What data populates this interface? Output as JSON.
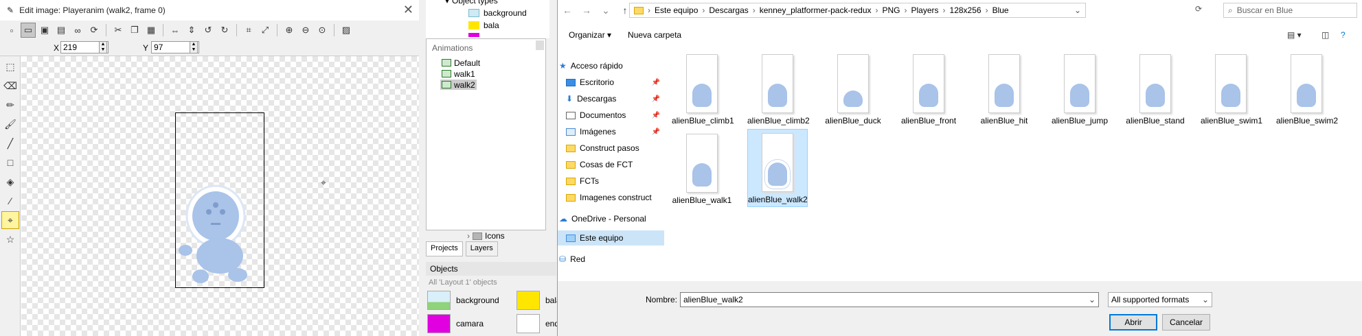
{
  "editor": {
    "title": "Edit image: Playeranim (walk2, frame 0)",
    "close": "✕",
    "x_label": "X",
    "x_value": "219",
    "y_label": "Y",
    "y_value": "97"
  },
  "object_types": {
    "header": "Object types",
    "items": [
      "background",
      "bala",
      "camara"
    ]
  },
  "animations": {
    "title": "Animations",
    "items": [
      "Default",
      "walk1",
      "walk2"
    ],
    "selected": "walk2"
  },
  "project_tabs": [
    "Projects",
    "Layers"
  ],
  "objects_panel": {
    "title": "Objects",
    "subtitle": "All 'Layout 1' objects",
    "items": [
      "background",
      "bala",
      "camara",
      "end"
    ]
  },
  "dialog": {
    "path": [
      "Este equipo",
      "Descargas",
      "kenney_platformer-pack-redux",
      "PNG",
      "Players",
      "128x256",
      "Blue"
    ],
    "search_placeholder": "Buscar en Blue",
    "organize": "Organizar",
    "new_folder": "Nueva carpeta",
    "nav": [
      {
        "label": "Acceso rápido",
        "pin": false
      },
      {
        "label": "Escritorio",
        "pin": true
      },
      {
        "label": "Descargas",
        "pin": true
      },
      {
        "label": "Documentos",
        "pin": true
      },
      {
        "label": "Imágenes",
        "pin": true
      },
      {
        "label": "Construct pasos",
        "pin": false
      },
      {
        "label": "Cosas de FCT",
        "pin": false
      },
      {
        "label": "FCTs",
        "pin": false
      },
      {
        "label": "Imagenes construct",
        "pin": false
      },
      {
        "label": "OneDrive - Personal",
        "pin": false
      },
      {
        "label": "Este equipo",
        "pin": false
      },
      {
        "label": "Red",
        "pin": false
      }
    ],
    "files": [
      "alienBlue_climb1",
      "alienBlue_climb2",
      "alienBlue_duck",
      "alienBlue_front",
      "alienBlue_hit",
      "alienBlue_jump",
      "alienBlue_stand",
      "alienBlue_swim1",
      "alienBlue_swim2",
      "alienBlue_walk1",
      "alienBlue_walk2"
    ],
    "selected_file": "alienBlue_walk2",
    "filename_label": "Nombre:",
    "filename_value": "alienBlue_walk2",
    "filter": "All supported formats",
    "open": "Abrir",
    "cancel": "Cancelar"
  },
  "colors": {
    "accent": "#0078d7",
    "selection": "#cce8ff",
    "alien": "#a9c3e9"
  }
}
